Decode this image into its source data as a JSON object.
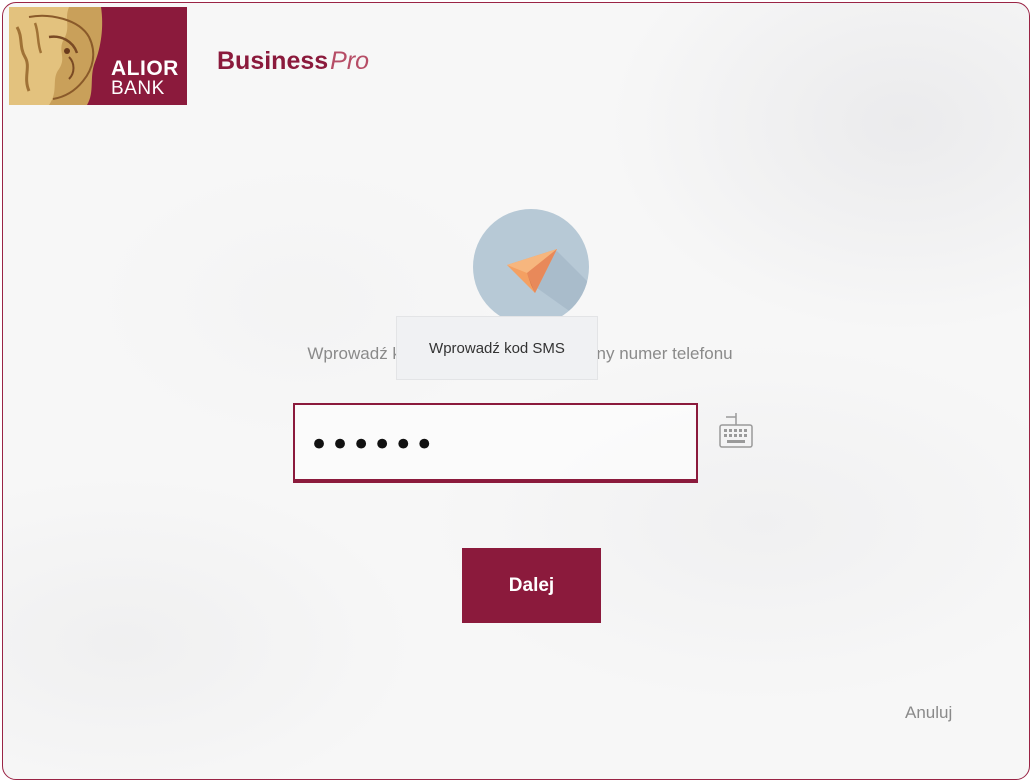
{
  "logo": {
    "line1": "ALIOR",
    "line2": "BANK"
  },
  "brand": {
    "bold": "Business",
    "italic": "Pro"
  },
  "sms_icon": "paper-plane-icon",
  "prompt": {
    "text": "Wprowadź kod SMS wysłany na zaufany numer telefonu"
  },
  "tooltip": {
    "text": "Wprowadź kod SMS"
  },
  "code_input": {
    "value": "••••••"
  },
  "keyboard_icon": "virtual-keyboard-icon",
  "next_button": {
    "label": "Dalej"
  },
  "cancel_link": {
    "label": "Anuluj"
  },
  "colors": {
    "brand": "#8b1a3c",
    "circle": "#b7c9d6",
    "plane": "#f4a062"
  }
}
